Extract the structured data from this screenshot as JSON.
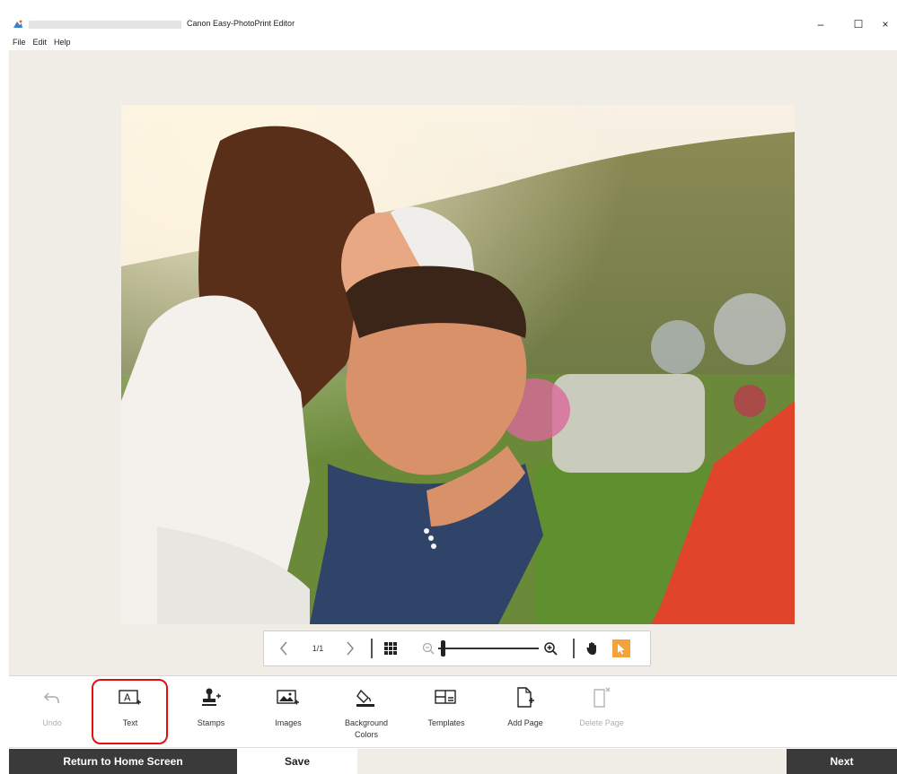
{
  "window": {
    "title": "Canon Easy-PhotoPrint Editor",
    "controls": {
      "minimize": "–",
      "maximize": "☐",
      "close": "×"
    }
  },
  "menu": {
    "file": "File",
    "edit": "Edit",
    "help": "Help"
  },
  "photo": {
    "description": "photo"
  },
  "viewbar": {
    "page": "1/1",
    "zoom_level": 0.05,
    "mode": "select"
  },
  "toolbar": {
    "undo": "Undo",
    "text": "Text",
    "stamps": "Stamps",
    "images": "Images",
    "background_colors_line1": "Background",
    "background_colors_line2": "Colors",
    "templates": "Templates",
    "add_page": "Add Page",
    "delete_page": "Delete Page"
  },
  "footer": {
    "return_home": "Return to Home Screen",
    "save": "Save",
    "next": "Next"
  },
  "colors": {
    "canvas_background": "#f0ede7",
    "accent": "#f4a33a",
    "dark_button": "#3a3a3a",
    "highlight": "#e01010"
  }
}
